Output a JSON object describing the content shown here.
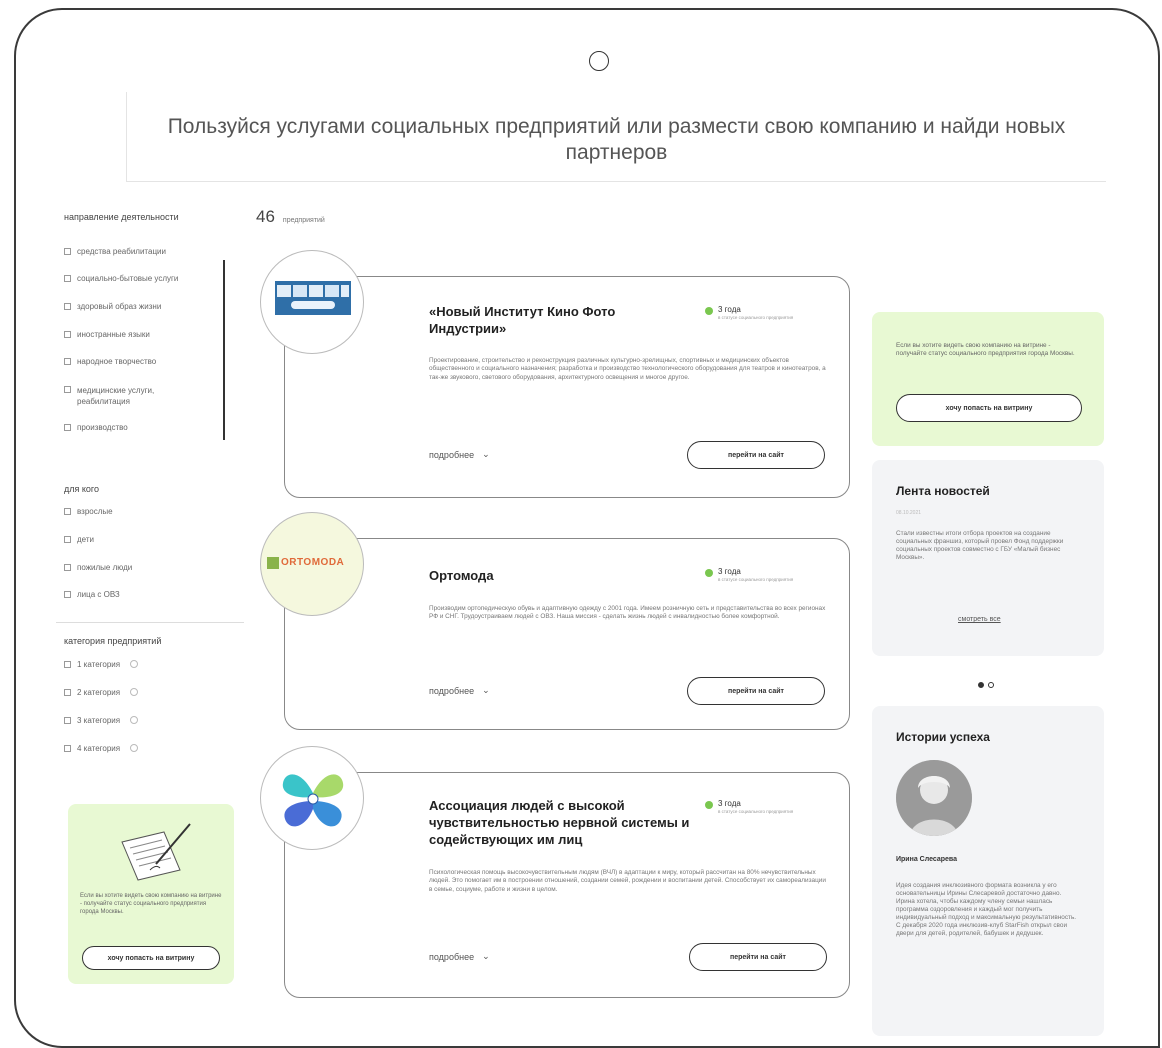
{
  "hero": {
    "text": "Пользуйся услугами социальных предприятий или размести свою компанию и найди новых партнеров"
  },
  "sidebar": {
    "section1_title": "направление деятельности",
    "activities": [
      "средства реабилитации",
      "социально-бытовые услуги",
      "здоровый образ жизни",
      "иностранные языки",
      "народное творчество",
      "медицинские услуги, реабилитация",
      "производство"
    ],
    "section2_title": "для кого",
    "audience": [
      "взрослые",
      "дети",
      "пожилые люди",
      "лица с ОВЗ"
    ],
    "section3_title": "категория предприятий",
    "categories": [
      "1 категория",
      "2 категория",
      "3 категория",
      "4 категория"
    ],
    "promo": {
      "text": "Если вы хотите видеть свою компанию на витрине - получайте статус социального предприятия города Москвы.",
      "button": "хочу попасть на витрину"
    }
  },
  "results": {
    "count": "46",
    "count_label": "предприятий"
  },
  "cards": [
    {
      "title": "«Новый Институт Кино Фото Индустрии»",
      "years": "3 года",
      "years_sub": "в статусе социального предприятия",
      "description": "Проектирование, строительство и реконструкция различных культурно-зрелищных, спортивных и медицинских объектов общественного и социального назначения; разработка и производство технологического оборудования для театров и кинотеатров, а так-же звукового, светового оборудования, архитектурного освещения и многое другое.",
      "more": "подробнее",
      "site": "перейти на сайт"
    },
    {
      "title": "Ортомода",
      "logo_text": "ORTOMODA",
      "years": "3 года",
      "years_sub": "в статусе социального предприятия",
      "description": "Производим ортопедическую обувь и адаптивную одежду с 2001 года. Имеем розничную сеть и представительства во всех регионах РФ и СНГ. Трудоустраиваем людей с ОВЗ. Наша миссия - сделать жизнь людей с инвалидностью более комфортной.",
      "more": "подробнее",
      "site": "перейти на сайт"
    },
    {
      "title": "Ассоциация людей с высокой чувствительностью нервной системы и содействующих им лиц",
      "years": "3 года",
      "years_sub": "в статусе социального предприятия",
      "description": "Психологическая помощь высокочувствительным людям (ВЧЛ) в адаптации к миру, который рассчитан на 80% нечувствительных людей. Это помогает им в построении отношений, создании семей, рождении и воспитании детей. Способствует их самореализации в семье, социуме, работе и жизни в целом.",
      "more": "подробнее",
      "site": "перейти на сайт"
    }
  ],
  "right": {
    "promo_text": "Если вы хотите видеть свою компанию на витрине - получайте статус социального предприятия города Москвы.",
    "promo_button": "хочу попасть на витрину",
    "news_title": "Лента новостей",
    "news_date": "08.10.2021",
    "news_text": "Стали известны итоги отбора проектов на создание социальных франшиз, который провел Фонд поддержки социальных проектов совместно с ГБУ «Малый бизнес Москвы».",
    "news_all": "смотреть все",
    "stories_title": "Истории успеха",
    "story_name": "Ирина Слесарева",
    "story_text": "Идея создания инклюзивного формата возникла у его основательницы Ирины Слесаревой достаточно давно. Ирина хотела, чтобы каждому члену семьи нашлась программа оздоровления и каждый мог получить индивидуальный подход и максимальную результативность. С декабря 2020 года инклюзив-клуб StarFish открыл свои двери для детей, родителей, бабушек и дедушек."
  },
  "colors": {
    "promo_green": "#e8f9d3",
    "accent_green": "#7ac74f",
    "panel_gray": "#f3f4f6"
  }
}
